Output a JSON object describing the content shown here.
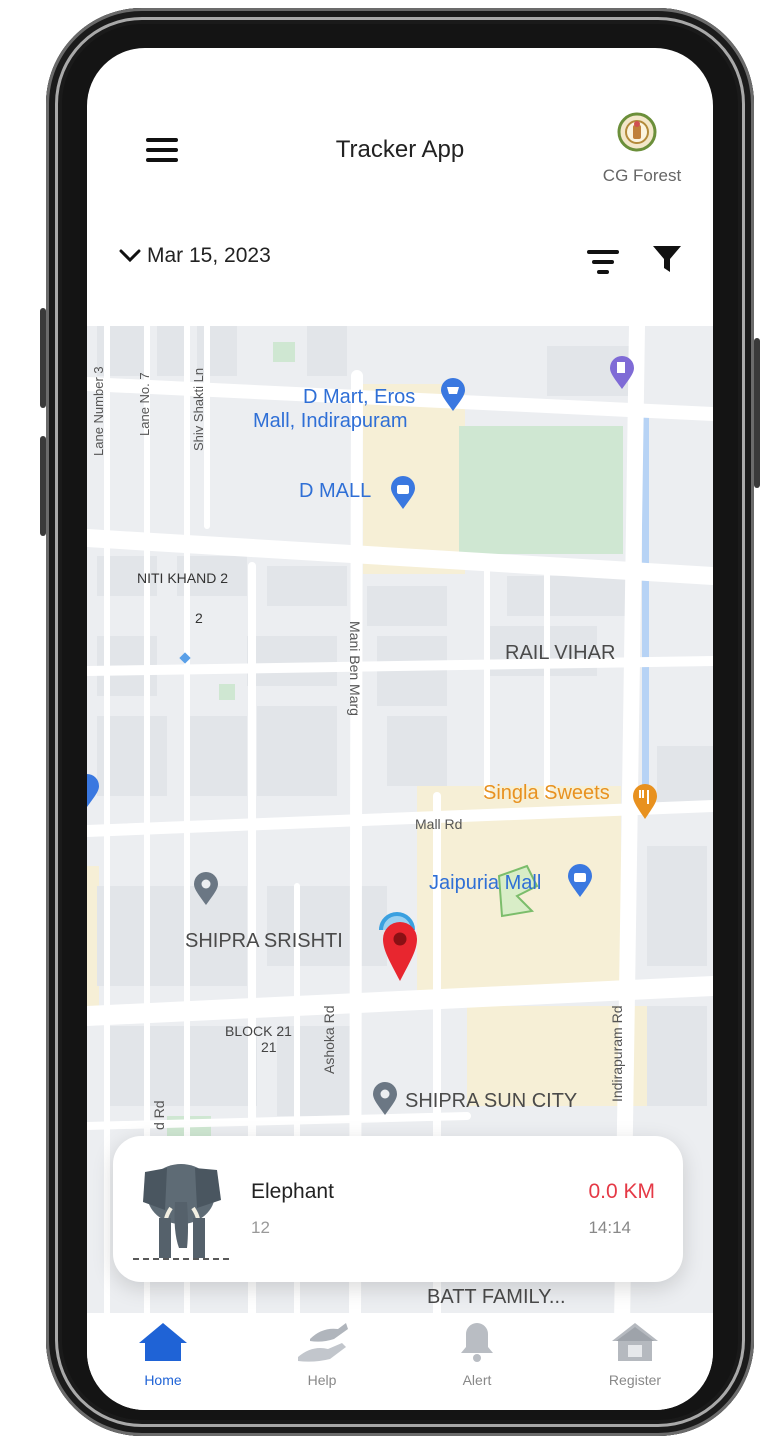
{
  "header": {
    "title": "Tracker App",
    "logo_caption": "CG Forest"
  },
  "filter_bar": {
    "date": "Mar 15, 2023"
  },
  "map": {
    "labels": [
      {
        "text": "D Mart, Eros",
        "type": "poi"
      },
      {
        "text": "Mall, Indirapuram",
        "type": "poi"
      },
      {
        "text": "D MALL",
        "type": "poi"
      },
      {
        "text": "Lane Number 3",
        "type": "street"
      },
      {
        "text": "Lane No. 7",
        "type": "street"
      },
      {
        "text": "Shiv Shakti Ln",
        "type": "street"
      },
      {
        "text": "NITI KHAND 2",
        "type": "area"
      },
      {
        "text": "2",
        "type": "area"
      },
      {
        "text": "Mani Ben Marg",
        "type": "street"
      },
      {
        "text": "RAIL VIHAR",
        "type": "area"
      },
      {
        "text": "Singla Sweets",
        "type": "food"
      },
      {
        "text": "Mall Rd",
        "type": "street"
      },
      {
        "text": "Jaipuria Mall",
        "type": "poi"
      },
      {
        "text": "SHIPRA SRISHTI",
        "type": "area"
      },
      {
        "text": "BLOCK 21",
        "type": "area"
      },
      {
        "text": "21",
        "type": "area"
      },
      {
        "text": "Ashoka Rd",
        "type": "street"
      },
      {
        "text": "SHIPRA SUN CITY",
        "type": "area"
      },
      {
        "text": "Indirapuram Rd",
        "type": "street"
      },
      {
        "text": "d Rd",
        "type": "street"
      },
      {
        "text": "BATT FAMILY...",
        "type": "area"
      }
    ]
  },
  "tracked_animal": {
    "name": "Elephant",
    "id": "12",
    "distance": "0.0 KM",
    "time": "14:14"
  },
  "bottom_nav": [
    {
      "label": "Home",
      "icon": "home-icon",
      "active": true
    },
    {
      "label": "Help",
      "icon": "help-hands-icon",
      "active": false
    },
    {
      "label": "Alert",
      "icon": "bell-icon",
      "active": false
    },
    {
      "label": "Register",
      "icon": "register-house-icon",
      "active": false
    }
  ],
  "colors": {
    "accent": "#1f63d6",
    "distance": "#e53946",
    "pin": "#e8262f",
    "poi_blue": "#2f6fd6",
    "food_orange": "#e8911f"
  }
}
